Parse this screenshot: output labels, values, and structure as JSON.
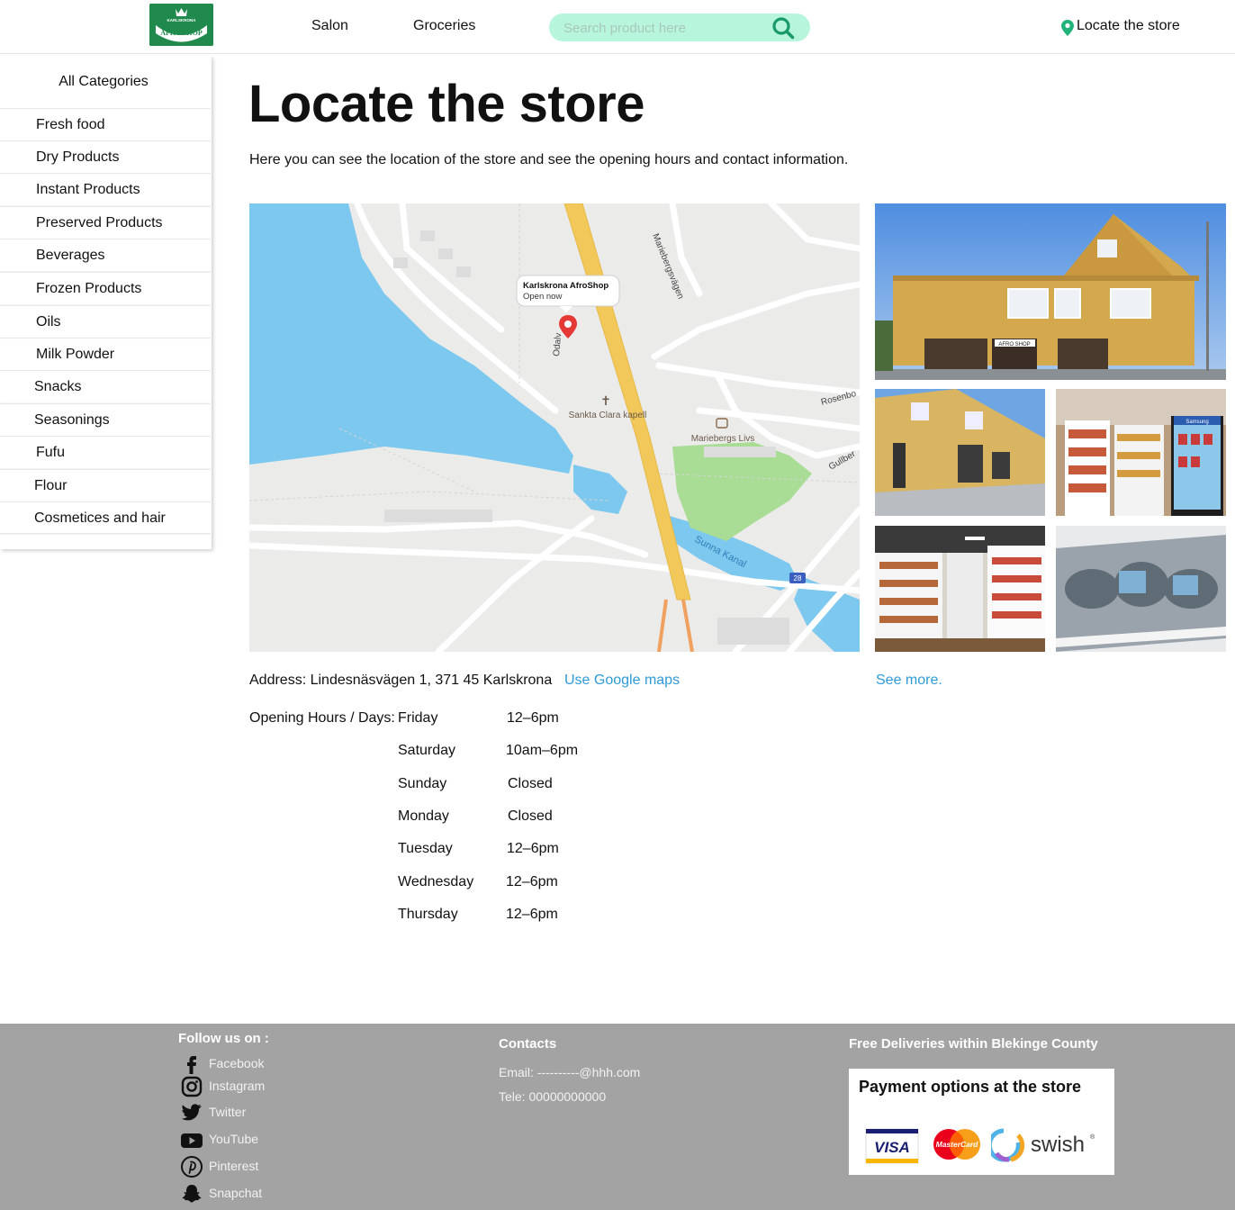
{
  "header": {
    "logo_top": "KARLSKRONA",
    "logo_main": "AFRO SHOP",
    "nav": [
      {
        "label": "Salon"
      },
      {
        "label": "Groceries"
      }
    ],
    "search_placeholder": "Search product here",
    "locate_label": "Locate the store"
  },
  "sidebar": {
    "title": "All Categories",
    "items": [
      {
        "label": "Fresh food"
      },
      {
        "label": "Dry Products"
      },
      {
        "label": "Instant Products"
      },
      {
        "label": "Preserved Products"
      },
      {
        "label": "Beverages"
      },
      {
        "label": "Frozen Products"
      },
      {
        "label": "Oils"
      },
      {
        "label": "Milk Powder"
      },
      {
        "label": "Snacks"
      },
      {
        "label": "Seasonings"
      },
      {
        "label": "Fufu"
      },
      {
        "label": "Flour"
      },
      {
        "label": "Cosmetices and hair"
      }
    ]
  },
  "main": {
    "title": "Locate the store",
    "intro": "Here you can see the location of the store and see the opening hours and contact information.",
    "map": {
      "pin_title": "Karlskrona AfroShop",
      "pin_status": "Open now",
      "labels": {
        "church": "Sankta Clara kapell",
        "shop": "Mariebergs Livs",
        "road1": "Mariebergsvägen",
        "road2": "Rosenbo",
        "road3": "Gullber",
        "road4": "Odalv",
        "canal": "Sunna Kanal",
        "route": "28"
      }
    },
    "photos": {
      "shop_sign": "AFRO SHOP",
      "fridge_sign": "Samsung"
    },
    "address": "Address: Lindesnäsvägen 1, 371 45 Karlskrona",
    "google_maps": "Use Google maps",
    "see_more": "See more.",
    "hours_label": "Opening Hours / Days:",
    "hours": [
      {
        "day": "Friday",
        "time": "12–6pm"
      },
      {
        "day": "Saturday",
        "time": "10am–6pm"
      },
      {
        "day": "Sunday",
        "time": "Closed"
      },
      {
        "day": "Monday",
        "time": "Closed"
      },
      {
        "day": "Tuesday",
        "time": "12–6pm"
      },
      {
        "day": "Wednesday",
        "time": "12–6pm"
      },
      {
        "day": "Thursday",
        "time": "12–6pm"
      }
    ]
  },
  "footer": {
    "follow_title": "Follow us on :",
    "socials": [
      {
        "label": "Facebook",
        "icon": "facebook-icon"
      },
      {
        "label": "Instagram",
        "icon": "instagram-icon"
      },
      {
        "label": "Twitter",
        "icon": "twitter-icon"
      },
      {
        "label": "YouTube",
        "icon": "youtube-icon"
      },
      {
        "label": "Pinterest",
        "icon": "pinterest-icon"
      },
      {
        "label": "Snapchat",
        "icon": "snapchat-icon"
      }
    ],
    "contacts_title": "Contacts",
    "email": "Email: ----------@hhh.com",
    "phone": "Tele: 00000000000",
    "delivery": "Free Deliveries within Blekinge County",
    "payment_title": "Payment options at the store",
    "payment_methods": {
      "visa": "VISA",
      "mastercard": "MasterCard",
      "swish": "swish"
    }
  },
  "colors": {
    "brand_green": "#1f8a4c",
    "search_bg": "#b8f5dd",
    "link_blue": "#2e9ad8",
    "footer_bg": "#a3a3a3",
    "water": "#7cc8ef",
    "park": "#a9dc95",
    "highway": "#f1c859"
  }
}
